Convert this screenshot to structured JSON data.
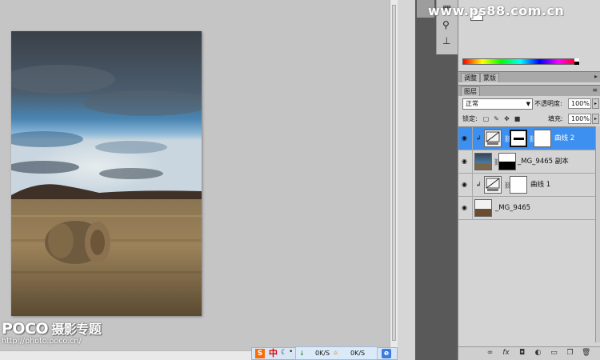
{
  "watermark_top": "www.ps88.com.cn",
  "panel_tabs_top": [
    "调整",
    "蒙版"
  ],
  "panel_tab_layers": "图层",
  "blend_mode": "正常",
  "opacity_label": "不透明度:",
  "opacity_value": "100%",
  "lock_label": "锁定:",
  "fill_label": "填充:",
  "fill_value": "100%",
  "layers": [
    {
      "name": "曲线 2",
      "selected": true,
      "type": "curves-adjustment"
    },
    {
      "name": "_MG_9465 副本",
      "selected": false,
      "type": "image-with-mask"
    },
    {
      "name": "曲线 1",
      "selected": false,
      "type": "curves-adjustment"
    },
    {
      "name": "_MG_9465",
      "selected": false,
      "type": "image"
    }
  ],
  "taskbar": {
    "ime_label": "中",
    "download_speed": "0K/S",
    "upload_speed": "0K/S"
  },
  "poco": {
    "brand": "POCO",
    "brand_cn": "摄影专题",
    "url": "http://photo.poco.cn/"
  }
}
